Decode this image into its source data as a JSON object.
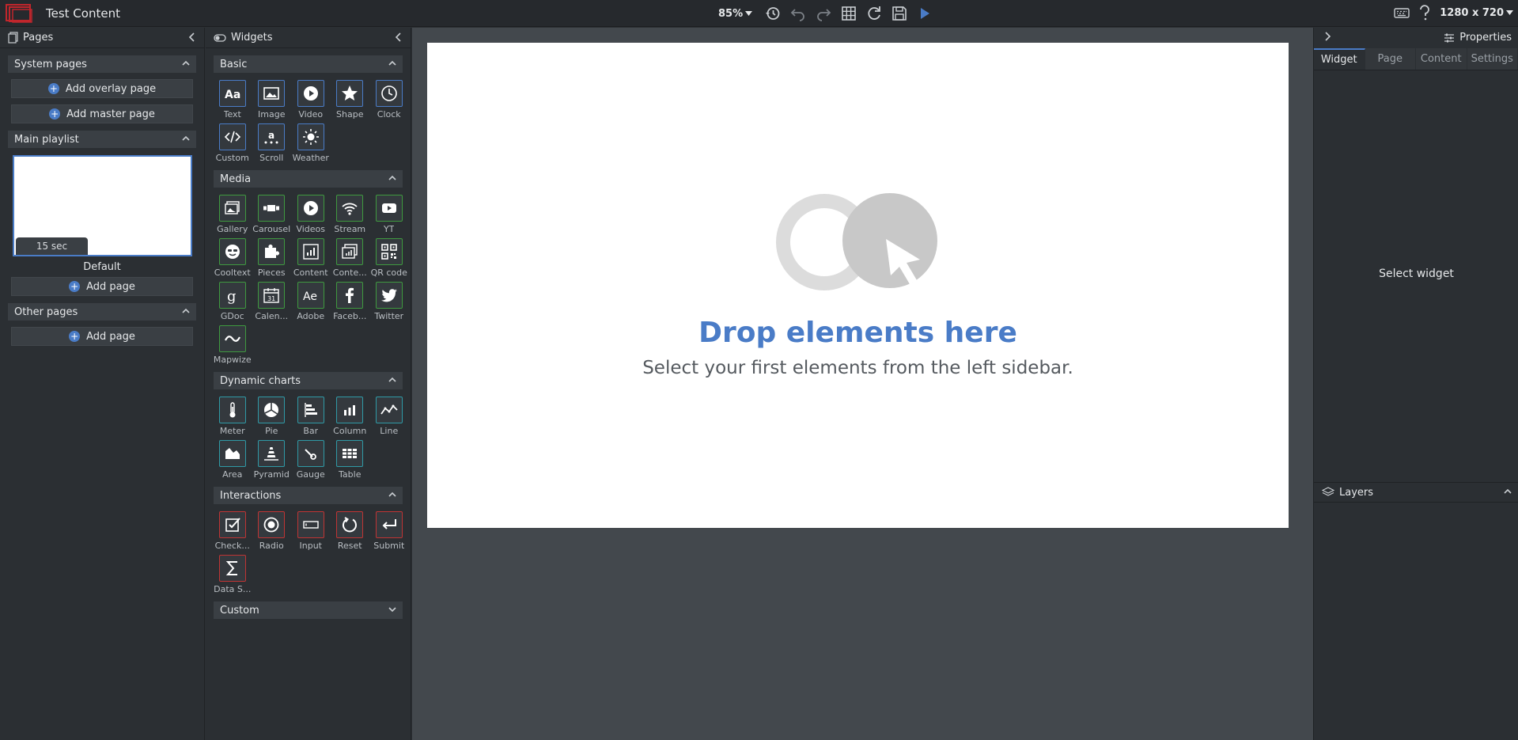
{
  "app": {
    "title": "Test Content"
  },
  "toolbar": {
    "zoom": "85%",
    "resolution": "1280 x 720"
  },
  "pages_panel": {
    "title": "Pages",
    "system_pages": {
      "title": "System pages",
      "add_overlay": "Add overlay page",
      "add_master": "Add master page"
    },
    "main_playlist": {
      "title": "Main playlist",
      "thumb_duration": "15 sec",
      "thumb_name": "Default",
      "add_page": "Add page"
    },
    "other_pages": {
      "title": "Other pages",
      "add_page": "Add page"
    }
  },
  "widgets_panel": {
    "title": "Widgets",
    "sections": {
      "basic": {
        "title": "Basic",
        "items": [
          "Text",
          "Image",
          "Video",
          "Shape",
          "Clock",
          "Custom",
          "Scroll",
          "Weather"
        ]
      },
      "media": {
        "title": "Media",
        "items": [
          "Gallery",
          "Carousel",
          "Videos",
          "Stream",
          "YT",
          "Cooltext",
          "Pieces",
          "Content",
          "Conte...",
          "QR code",
          "GDoc",
          "Calen...",
          "Adobe",
          "Faceb...",
          "Twitter",
          "Mapwize"
        ]
      },
      "charts": {
        "title": "Dynamic charts",
        "items": [
          "Meter",
          "Pie",
          "Bar",
          "Column",
          "Line",
          "Area",
          "Pyramid",
          "Gauge",
          "Table"
        ]
      },
      "interactions": {
        "title": "Interactions",
        "items": [
          "Check...",
          "Radio",
          "Input",
          "Reset",
          "Submit",
          "Data S..."
        ]
      },
      "custom": {
        "title": "Custom"
      }
    }
  },
  "canvas": {
    "drop_title": "Drop elements here",
    "drop_subtitle": "Select your first elements from the left sidebar."
  },
  "properties_panel": {
    "title": "Properties",
    "tabs": [
      "Widget",
      "Page",
      "Content",
      "Settings"
    ],
    "active_tab": "Widget",
    "empty_text": "Select widget",
    "layers_title": "Layers"
  },
  "colors": {
    "accent": "#4a7cc7",
    "media": "#3f9a3f",
    "charts": "#2f9aa6",
    "interactions": "#c03434"
  }
}
